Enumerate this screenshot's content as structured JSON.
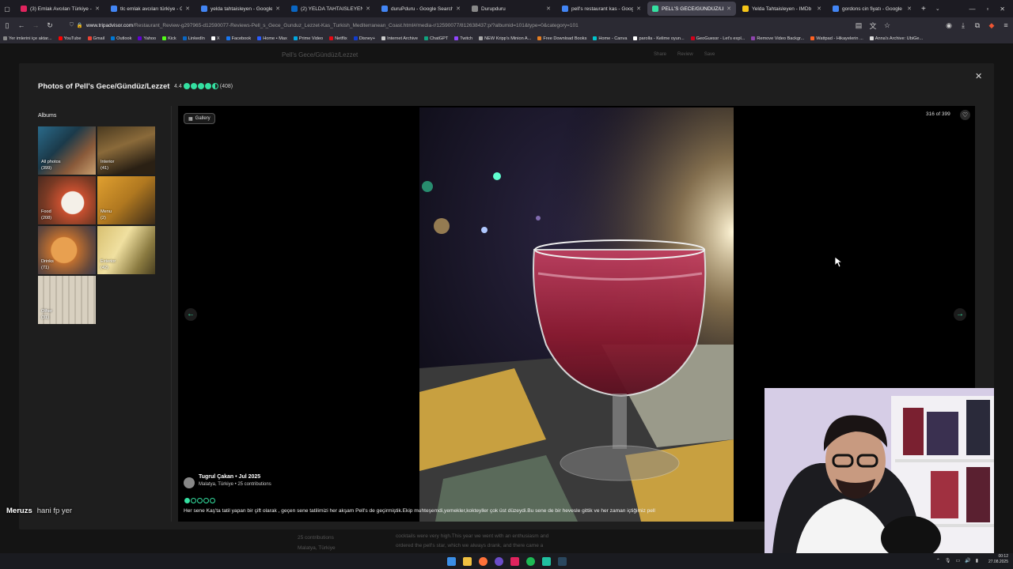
{
  "browser": {
    "tabs": [
      {
        "title": "(3) Emlak Avcıları Türkiye - 4. Bö",
        "color": "#e0245e"
      },
      {
        "title": "tlc emlak avcıları türkiye - Goog",
        "color": "#4285f4"
      },
      {
        "title": "yelda tahtaisleyen - Google Sear",
        "color": "#4285f4"
      },
      {
        "title": "(2) YELDA TAHTAISLEYEN | Linke",
        "color": "#0a66c2"
      },
      {
        "title": "duruPduru - Google Search",
        "color": "#4285f4"
      },
      {
        "title": "Durupduru",
        "color": "#888888"
      },
      {
        "title": "pell's restaurant kas - Google Se",
        "color": "#4285f4"
      },
      {
        "title": "PELL'S GECE/GÜNDÜZ/LEZZET",
        "color": "#34e0a1",
        "active": true
      },
      {
        "title": "Yelda Tahtaisleyen - IMDb",
        "color": "#f5c518"
      },
      {
        "title": "gordons cin fiyatı - Google Sear",
        "color": "#4285f4"
      }
    ],
    "new_tab": "+",
    "url_domain": "www.tripadvisor.com",
    "url_path": "/Restaurant_Review-g297965-d12590077-Reviews-Pell_s_Gece_Gunduz_Lezzet-Kas_Turkish_Mediterranean_Coast.html#/media-r/12590077/812638437:p/?albumid=101&type=0&category=101",
    "bookmarks": [
      {
        "label": "Yer imlerini içe aktar...",
        "color": "#888888"
      },
      {
        "label": "YouTube",
        "color": "#ff0000"
      },
      {
        "label": "Gmail",
        "color": "#ea4335"
      },
      {
        "label": "Outlook",
        "color": "#0078d4"
      },
      {
        "label": "Yahoo",
        "color": "#6001d2"
      },
      {
        "label": "Kick",
        "color": "#53fc18"
      },
      {
        "label": "LinkedIn",
        "color": "#0a66c2"
      },
      {
        "label": "X",
        "color": "#ffffff"
      },
      {
        "label": "Facebook",
        "color": "#1877f2"
      },
      {
        "label": "Home • Max",
        "color": "#2a5cff"
      },
      {
        "label": "Prime Video",
        "color": "#00a8e1"
      },
      {
        "label": "Netflix",
        "color": "#e50914"
      },
      {
        "label": "Disney+",
        "color": "#113ccf"
      },
      {
        "label": "Internet Archive",
        "color": "#cccccc"
      },
      {
        "label": "ChatGPT",
        "color": "#10a37f"
      },
      {
        "label": "Twitch",
        "color": "#9146ff"
      },
      {
        "label": "NEW Kripp's Minion A...",
        "color": "#aaaaaa"
      },
      {
        "label": "Free Download Books",
        "color": "#e67e22"
      },
      {
        "label": "Home - Canva",
        "color": "#00c4cc"
      },
      {
        "label": "parolla - Kelime oyun...",
        "color": "#ffffff"
      },
      {
        "label": "GeoGuessr - Let's expl...",
        "color": "#d0021b"
      },
      {
        "label": "Remove Video Backgr...",
        "color": "#8e44ad"
      },
      {
        "label": "Wattpad - Hikayelerin ...",
        "color": "#ff6122"
      },
      {
        "label": "Anna's Archive: UbiGe...",
        "color": "#dddddd"
      }
    ]
  },
  "page": {
    "bg_title": "Pell's Gece/Gündüz/Lezzet",
    "bg_actions": [
      "Share",
      "Review",
      "Save"
    ],
    "under_left": [
      "25 contributions",
      "Malatya, Türkiye"
    ],
    "under_right": [
      "cocktails were very high.This year we went with an enthusiasm and",
      "ordered the pell's star, which we always drank, and there came a"
    ]
  },
  "modal": {
    "title": "Photos of Pell's Gece/Gündüz/Lezzet",
    "rating_value": "4.4",
    "rating_bubbles": 4.5,
    "review_count": "(408)",
    "albums_heading": "Albums",
    "albums": [
      {
        "name": "All photos",
        "count": "(399)"
      },
      {
        "name": "Interior",
        "count": "(41)"
      },
      {
        "name": "Food",
        "count": "(208)"
      },
      {
        "name": "Menu",
        "count": "(2)"
      },
      {
        "name": "Drinks",
        "count": "(71)"
      },
      {
        "name": "Exterior",
        "count": "(42)"
      },
      {
        "name": "Other",
        "count": "(31)"
      }
    ],
    "gallery_label": "Gallery",
    "counter": "316 of 399",
    "author_name": "Tugrul Çakan • Jul 2025",
    "author_meta": "Malatya, Türkiye • 25 contributions",
    "review_rating": 1,
    "review_text": "Her sene Kaş'ta tatil yapan bir çift olarak , geçen sene tatilimizi her akşam Pell's de geçirmiştik.Ekip muhteşemdi,yemekler,kokteyller çok üst düzeydi.Bu sene de bir hevesle gittik ve her zaman içtiğimiz pell"
  },
  "stream": {
    "chat_user": "Meruzs",
    "chat_message": "hani fp yer"
  },
  "system": {
    "time": "00:12",
    "date": "27.08.2025"
  },
  "colors": {
    "accent": "#34e0a1",
    "tab_active": "#42414d"
  }
}
